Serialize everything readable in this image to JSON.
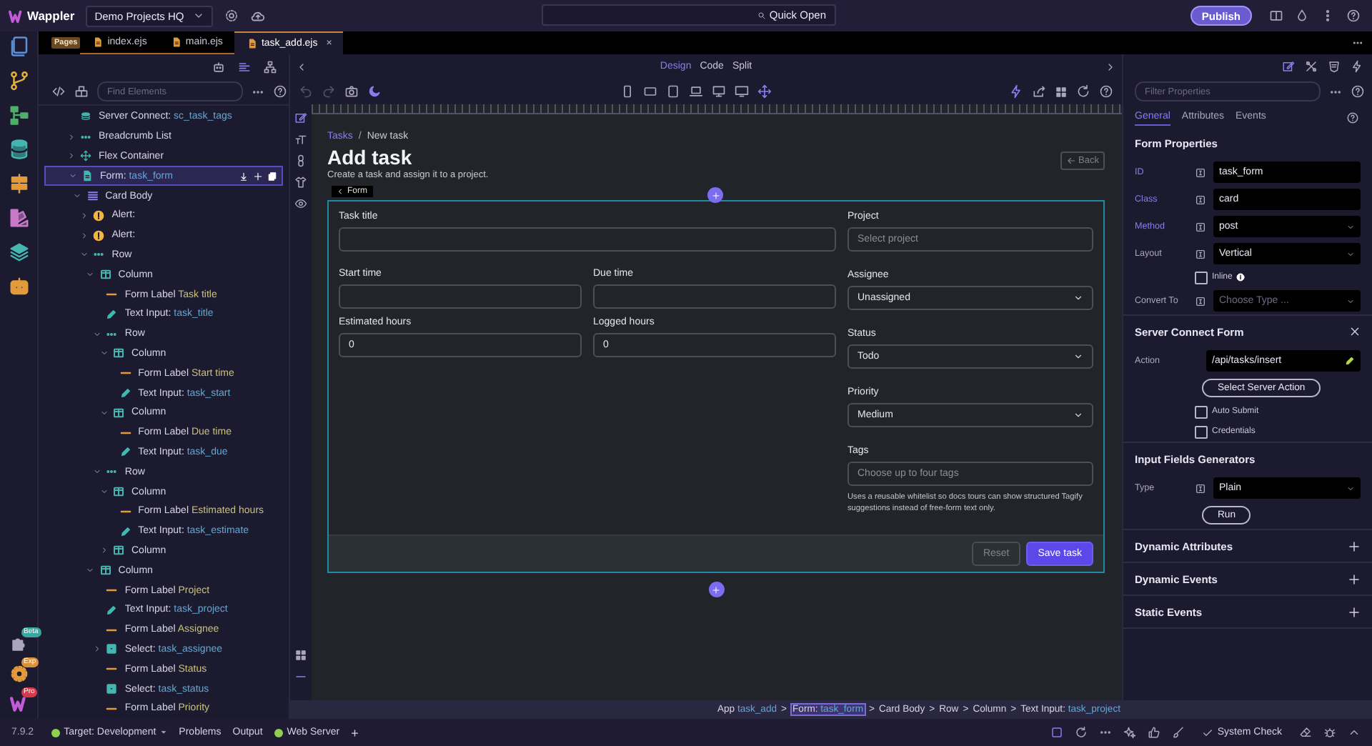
{
  "topbar": {
    "app_name": "Wappler",
    "project": "Demo Projects HQ",
    "quick_open": "Quick Open",
    "publish": "Publish"
  },
  "activity_badges": [
    {
      "label": "Beta",
      "color": "#3aa6a0"
    },
    {
      "label": "Exp",
      "color": "#d9913a"
    },
    {
      "label": "Pro",
      "color": "#d63a4a"
    }
  ],
  "pages_badge": "Pages",
  "file_tabs": [
    {
      "label": "index.ejs",
      "selected": false
    },
    {
      "label": "main.ejs",
      "selected": false
    },
    {
      "label": "task_add.ejs",
      "selected": true,
      "close": "×"
    }
  ],
  "structure": {
    "search_placeholder": "Find Elements"
  },
  "tree": [
    {
      "kind": "server-connect",
      "label": "Server Connect:",
      "value": "sc_task_tags",
      "selected": false
    },
    {
      "kind": "breadcrumb",
      "label": "Breadcrumb List",
      "expanded": false,
      "selected": false
    },
    {
      "kind": "flex",
      "label": "Flex Container",
      "expanded": false,
      "selected": false
    },
    {
      "kind": "form",
      "label": "Form:",
      "value": "task_form",
      "expanded": true,
      "selected": true,
      "children": [
        {
          "kind": "card-body",
          "label": "Card Body",
          "expanded": true,
          "selected": false,
          "children": [
            {
              "kind": "alert",
              "label": "Alert:",
              "expanded": false,
              "selected": false
            },
            {
              "kind": "alert",
              "label": "Alert:",
              "expanded": false,
              "selected": false
            },
            {
              "kind": "row",
              "label": "Row",
              "expanded": true,
              "selected": false,
              "children": [
                {
                  "kind": "column",
                  "label": "Column",
                  "expanded": true,
                  "selected": false,
                  "children": [
                    {
                      "kind": "label",
                      "label": "Form Label",
                      "value": "Task title",
                      "selected": false
                    },
                    {
                      "kind": "input",
                      "label": "Text Input:",
                      "value": "task_title",
                      "selected": false
                    },
                    {
                      "kind": "row",
                      "label": "Row",
                      "expanded": true,
                      "selected": false,
                      "children": [
                        {
                          "kind": "column",
                          "label": "Column",
                          "expanded": true,
                          "selected": false,
                          "children": [
                            {
                              "kind": "label",
                              "label": "Form Label",
                              "value": "Start time",
                              "selected": false
                            },
                            {
                              "kind": "input",
                              "label": "Text Input:",
                              "value": "task_start",
                              "selected": false
                            }
                          ]
                        },
                        {
                          "kind": "column",
                          "label": "Column",
                          "expanded": true,
                          "selected": false,
                          "children": [
                            {
                              "kind": "label",
                              "label": "Form Label",
                              "value": "Due time",
                              "selected": false
                            },
                            {
                              "kind": "input",
                              "label": "Text Input:",
                              "value": "task_due",
                              "selected": false
                            }
                          ]
                        }
                      ]
                    },
                    {
                      "kind": "row",
                      "label": "Row",
                      "expanded": true,
                      "selected": false,
                      "children": [
                        {
                          "kind": "column",
                          "label": "Column",
                          "expanded": true,
                          "selected": false,
                          "children": [
                            {
                              "kind": "label",
                              "label": "Form Label",
                              "value": "Estimated hours",
                              "selected": false
                            },
                            {
                              "kind": "input",
                              "label": "Text Input:",
                              "value": "task_estimate",
                              "selected": false
                            }
                          ]
                        },
                        {
                          "kind": "column",
                          "label": "Column",
                          "expanded": false,
                          "selected": false
                        }
                      ]
                    }
                  ]
                },
                {
                  "kind": "column",
                  "label": "Column",
                  "expanded": true,
                  "selected": false,
                  "children": [
                    {
                      "kind": "label",
                      "label": "Form Label",
                      "value": "Project",
                      "selected": false
                    },
                    {
                      "kind": "input",
                      "label": "Text Input:",
                      "value": "task_project",
                      "selected": false
                    },
                    {
                      "kind": "label",
                      "label": "Form Label",
                      "value": "Assignee",
                      "selected": false
                    },
                    {
                      "kind": "select",
                      "label": "Select:",
                      "value": "task_assignee",
                      "expanded": false,
                      "selected": false
                    },
                    {
                      "kind": "label",
                      "label": "Form Label",
                      "value": "Status",
                      "selected": false
                    },
                    {
                      "kind": "select",
                      "label": "Select:",
                      "value": "task_status",
                      "selected": false
                    },
                    {
                      "kind": "label",
                      "label": "Form Label",
                      "value": "Priority",
                      "selected": false
                    }
                  ]
                }
              ]
            }
          ]
        }
      ]
    }
  ],
  "view_modes": [
    {
      "label": "Design",
      "selected": true
    },
    {
      "label": "Code",
      "selected": false
    },
    {
      "label": "Split",
      "selected": false
    }
  ],
  "canvas": {
    "breadcrumb": [
      {
        "label": "Tasks",
        "link": true,
        "separator": "/"
      },
      {
        "label": "New task",
        "link": false
      }
    ],
    "title": "Add task",
    "subtitle": "Create a task and assign it to a project.",
    "back": "Back",
    "selection_tag": "Form",
    "left_rows": [
      [
        {
          "label": "Task title"
        }
      ],
      [
        {
          "label": "Start time"
        },
        {
          "label": "Due time"
        }
      ],
      [
        {
          "label": "Estimated hours",
          "value": "0"
        },
        {
          "label": "Logged hours",
          "value": "0"
        }
      ]
    ],
    "right_fields": [
      {
        "kind": "input",
        "label": "Project",
        "placeholder": "Select project"
      },
      {
        "kind": "select",
        "label": "Assignee",
        "value": "Unassigned"
      },
      {
        "kind": "select",
        "label": "Status",
        "value": "Todo"
      },
      {
        "kind": "select",
        "label": "Priority",
        "value": "Medium"
      },
      {
        "kind": "input",
        "label": "Tags",
        "placeholder": "Choose up to four tags",
        "help": "Uses a reusable whitelist so docs tours can show structured Tagify suggestions instead of free-form text only."
      }
    ],
    "buttons": [
      {
        "label": "Reset",
        "kind": "secondary",
        "disabled": true
      },
      {
        "label": "Save task",
        "kind": "primary",
        "disabled": false
      }
    ]
  },
  "path_bar": [
    {
      "label": "App",
      "value": "task_add",
      "selected": false,
      "separator": ">"
    },
    {
      "label": "Form:",
      "value": "task_form",
      "selected": true,
      "separator": ">"
    },
    {
      "label": "Card Body",
      "selected": false,
      "separator": ">"
    },
    {
      "label": "Row",
      "selected": false,
      "separator": ">"
    },
    {
      "label": "Column",
      "selected": false,
      "separator": ">"
    },
    {
      "label": "Text Input:",
      "value": "task_project",
      "selected": false
    }
  ],
  "properties": {
    "filter_placeholder": "Filter Properties",
    "tabs": [
      {
        "label": "General",
        "selected": true
      },
      {
        "label": "Attributes",
        "selected": false
      },
      {
        "label": "Events",
        "selected": false
      }
    ],
    "sections": [
      {
        "title": "Form Properties",
        "expanded": true,
        "closable": false,
        "rows": [
          {
            "kind": "text",
            "label": "ID",
            "set": true,
            "value": "task_form"
          },
          {
            "kind": "text",
            "label": "Class",
            "set": true,
            "value": "card"
          },
          {
            "kind": "select",
            "label": "Method",
            "set": true,
            "value": "post"
          },
          {
            "kind": "select",
            "label": "Layout",
            "set": false,
            "value": "Vertical"
          },
          {
            "kind": "checkbox",
            "label": "Inline",
            "checked": false,
            "info": true
          },
          {
            "kind": "select",
            "label": "Convert To",
            "set": false,
            "placeholder": "Choose Type ..."
          }
        ]
      },
      {
        "title": "Server Connect Form",
        "expanded": true,
        "closable": true,
        "rows": [
          {
            "kind": "action",
            "label": "Action",
            "set": false,
            "value": "/api/tasks/insert"
          },
          {
            "kind": "button",
            "label": "Select Server Action"
          },
          {
            "kind": "checkbox",
            "label": "Auto Submit",
            "checked": false,
            "info": false
          },
          {
            "kind": "checkbox",
            "label": "Credentials",
            "checked": false,
            "info": false
          }
        ]
      },
      {
        "title": "Input Fields Generators",
        "expanded": true,
        "closable": false,
        "rows": [
          {
            "kind": "select",
            "label": "Type",
            "set": false,
            "value": "Plain"
          },
          {
            "kind": "button",
            "label": "Run"
          }
        ]
      },
      {
        "title": "Dynamic Attributes",
        "expanded": false,
        "closable": false
      },
      {
        "title": "Dynamic Events",
        "expanded": false,
        "closable": false
      },
      {
        "title": "Static Events",
        "expanded": false,
        "closable": false
      }
    ]
  },
  "status_bar": {
    "version": "7.9.2",
    "items": [
      {
        "label": "Target: Development",
        "color": "#8fd14f",
        "dropdown": true
      },
      {
        "label": "Problems",
        "dropdown": false
      },
      {
        "label": "Output",
        "dropdown": false
      },
      {
        "label": "Web Server",
        "color": "#8fd14f",
        "dropdown": false
      }
    ],
    "add": "+",
    "system_check": "System Check"
  }
}
